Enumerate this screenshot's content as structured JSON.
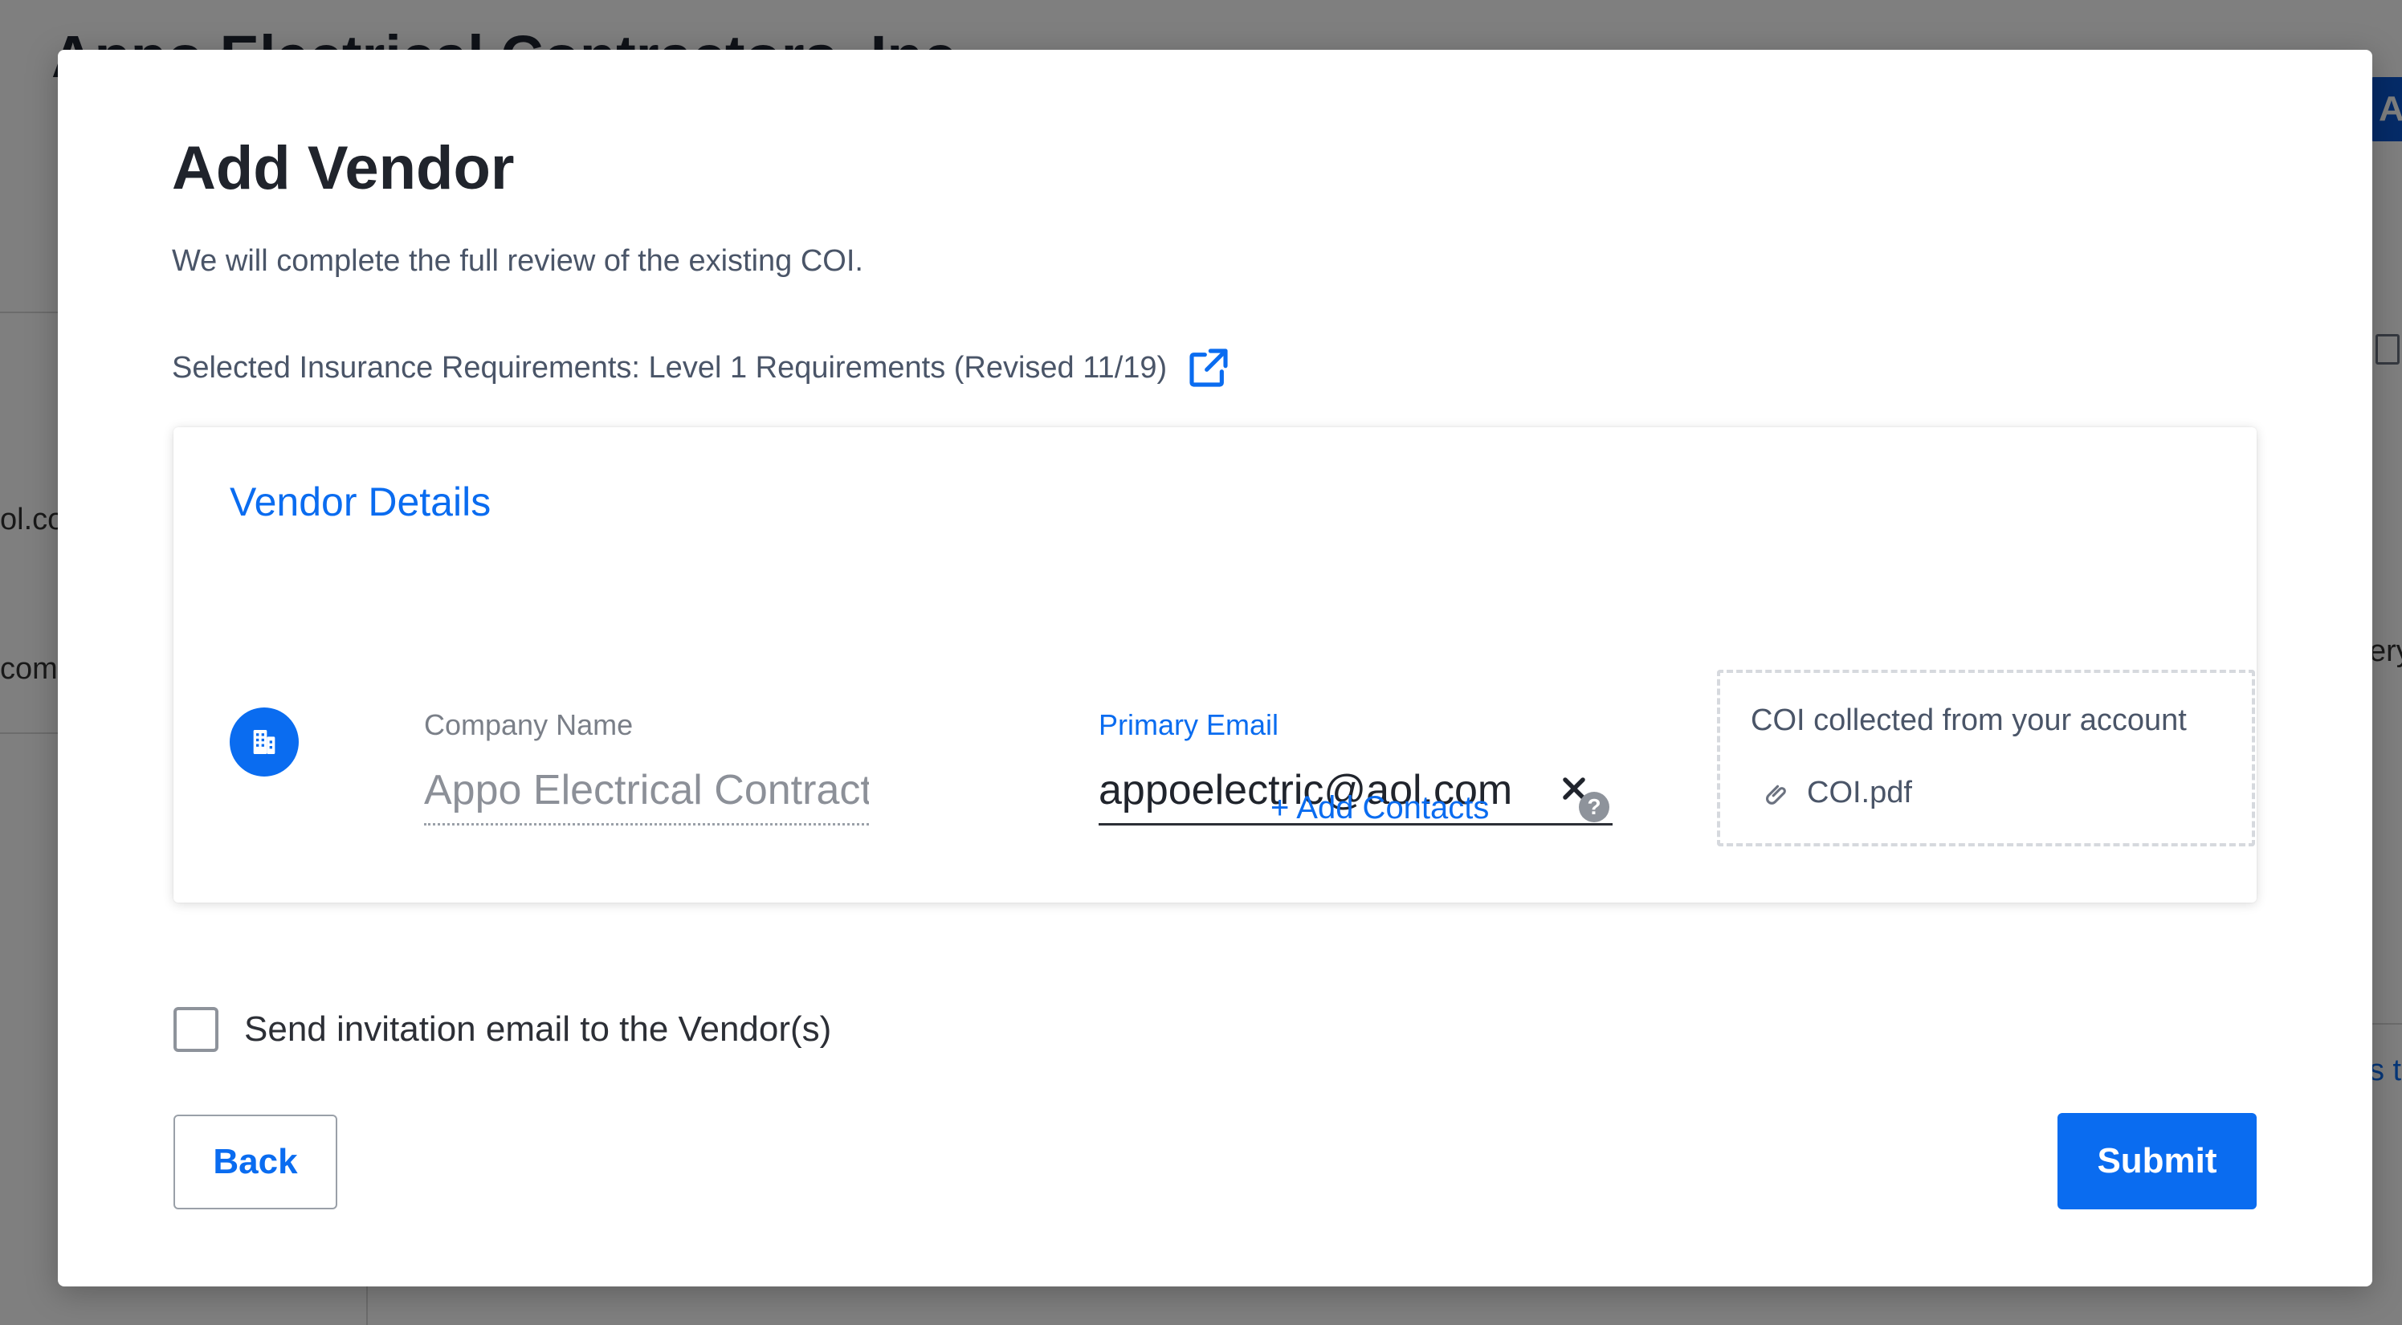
{
  "background": {
    "page_title": "Appo Electrical Contractors, Inc",
    "left_text_1": "ol.co",
    "left_text_2": "com",
    "right_button": "A",
    "right_text_1": "ery",
    "right_text_2": "s th"
  },
  "modal": {
    "title": "Add Vendor",
    "subtitle": "We will complete the full review of the existing COI.",
    "requirements_text": "Selected Insurance Requirements: Level 1 Requirements (Revised 11/19)",
    "vendor_card": {
      "title": "Vendor Details",
      "company_name": {
        "label": "Company Name",
        "value": "Appo Electrical Contractors, Inc"
      },
      "primary_email": {
        "label": "Primary Email",
        "value": "appoelectric@aol.com"
      },
      "add_contacts_label": "+ Add Contacts",
      "help_glyph": "?",
      "coi": {
        "title": "COI collected from your account",
        "file_name": "COI.pdf"
      }
    },
    "invite_label": "Send invitation email to the Vendor(s)",
    "invite_checked": false,
    "back_label": "Back",
    "submit_label": "Submit"
  },
  "colors": {
    "accent": "#0a6cf0",
    "overlay": "rgba(0,0,0,0.5)"
  },
  "icons": [
    "external-link-icon",
    "building-icon",
    "close-icon",
    "help-icon",
    "paperclip-icon"
  ]
}
